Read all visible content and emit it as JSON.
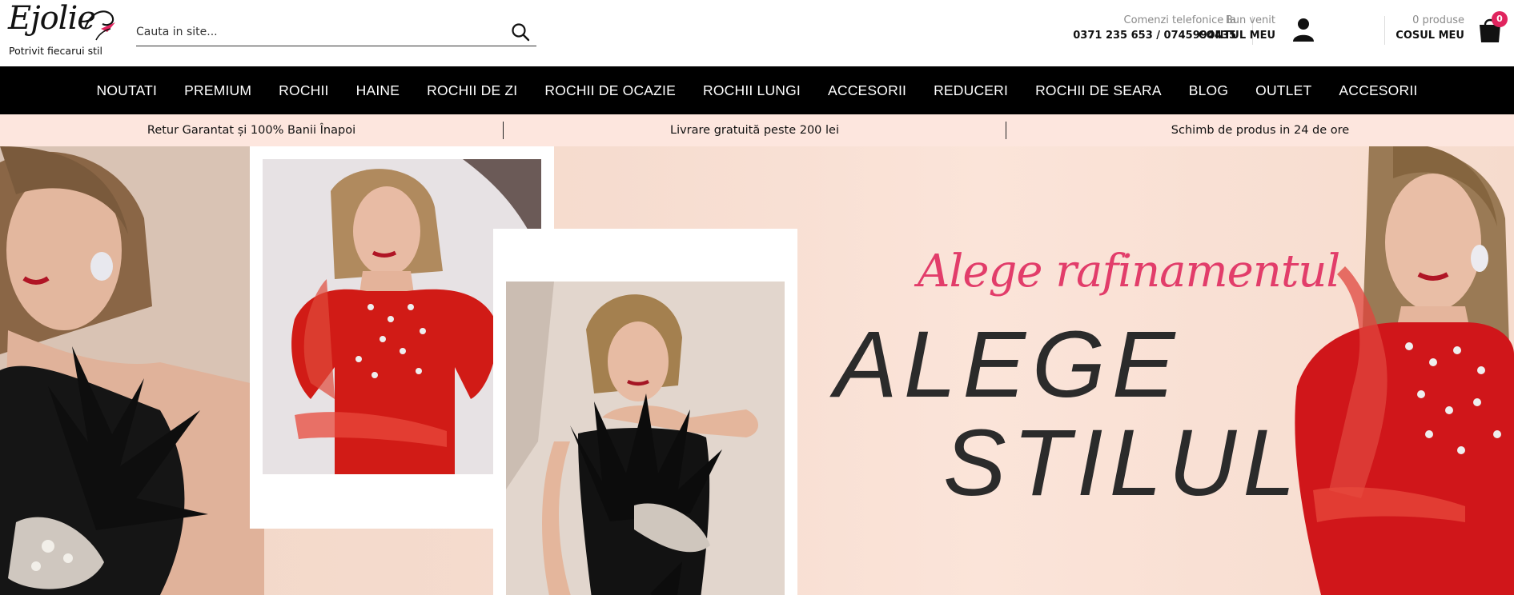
{
  "brand": {
    "logo_text": "Ejolie",
    "tagline": "Potrivit fiecarui stil"
  },
  "search": {
    "placeholder": "Cauta in site...",
    "value": ""
  },
  "header": {
    "phone_label": "Comenzi telefonice la",
    "phone_numbers": "0371 235 653 / 0745994435",
    "account_greeting": "Bun venit",
    "account_link": "CONTUL MEU",
    "cart_count_label": "0 produse",
    "cart_link": "COSUL MEU",
    "cart_badge": "0"
  },
  "nav": {
    "items": [
      "NOUTATI",
      "PREMIUM",
      "ROCHII",
      "HAINE",
      "ROCHII DE ZI",
      "ROCHII DE OCAZIE",
      "ROCHII LUNGI",
      "ACCESORII",
      "REDUCERI",
      "ROCHII DE SEARA",
      "BLOG",
      "OUTLET",
      "ACCESORII"
    ]
  },
  "infobar": {
    "items": [
      "Retur Garantat și 100% Banii Înapoi",
      "Livrare gratuită peste 200 lei",
      "Schimb de produs in 24 de ore"
    ]
  },
  "hero": {
    "script_line": "Alege rafinamentul",
    "headline_line1": "ALEGE",
    "headline_line2": "STILUL"
  },
  "colors": {
    "accent": "#e0245e",
    "script": "#e23d6a",
    "nav_bg": "#000000",
    "infobar_bg": "#fde6de",
    "headline": "#2b2b2b"
  },
  "icons": {
    "search": "search-icon",
    "user": "user-icon",
    "cart": "shopping-bag-icon"
  }
}
